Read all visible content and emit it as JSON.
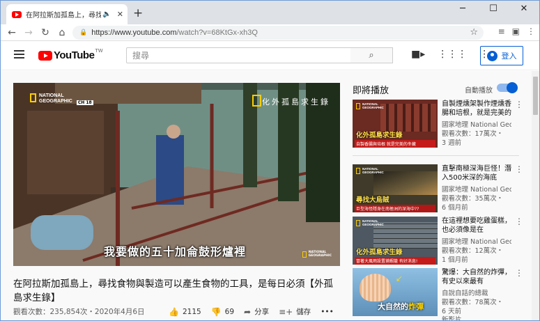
{
  "browser": {
    "tab_title": "在阿拉斯加孤島上，尋找食物",
    "tab_audio_icon": "speaker-icon",
    "new_tab_label": "+",
    "window_controls": [
      "─",
      "☐",
      "✕"
    ],
    "url_prefix": "https://www.youtube.com",
    "url_path": "/watch?v=68KtGx-xh3Q"
  },
  "youtube": {
    "logo_text": "YouTube",
    "region": "TW",
    "search_placeholder": "搜尋",
    "signin_label": "登入"
  },
  "video": {
    "channel_badge_line1": "NATIONAL",
    "channel_badge_line2": "GEOGRAPHIC",
    "channel_number": "CH 18",
    "program_title": "化外孤島求生錄",
    "subtitle": "我要做的五十加侖鼓形爐裡",
    "title": "在阿拉斯加孤島上，尋找食物與製造可以產生食物的工具，是每日必須【外孤島求生錄】",
    "views_date": "觀看次數：235,854次・2020年4月6日",
    "likes": "2115",
    "dislikes": "69",
    "share_label": "分享",
    "save_label": "儲存",
    "more_label": "•••"
  },
  "sidebar": {
    "up_next_label": "即將播放",
    "autoplay_label": "自動播放",
    "autoplay_on": true,
    "items": [
      {
        "title": "自製煙燻架製作煙燻香腸和培根，就是完美的冬藏",
        "channel": "國家地理 National Geographic",
        "views": "觀看次數：17萬次・",
        "age": "3 週前",
        "thumb_caption": "化外孤島求生錄",
        "thumb_sub": "自製香腸與培根 就是完美的冬藏",
        "thumb_color": "#6b2a22"
      },
      {
        "title": "直擊南極深海巨怪！潛入500米深的海底",
        "channel": "國家地理 National Geographic",
        "views": "觀看次數：35萬次・",
        "age": "6 個月前",
        "thumb_caption": "尋找大烏賊",
        "thumb_sub": "巨型海怪隱身在南極洲的深海中??",
        "thumb_color": "#3f3a2a"
      },
      {
        "title": "在這裡想要吃雞蛋糕，也必須像是在",
        "channel": "國家地理 National Geographic",
        "views": "觀看次數：12萬次・",
        "age": "1 個月前",
        "thumb_caption": "化外孤島求生錄",
        "thumb_sub": "冒著大風雨設置捕蝦籠 有好消息!",
        "thumb_color": "#4d5863"
      },
      {
        "title": "驚爆：大自然的炸彈，有史以來最有",
        "channel": "自說自話的總裁",
        "views": "觀看次數：78萬次・",
        "age": "6 天前",
        "extra": "新影片",
        "thumb_big_a": "大自然的",
        "thumb_big_b": "炸彈",
        "thumb_color": "#7fb3d8"
      }
    ]
  }
}
